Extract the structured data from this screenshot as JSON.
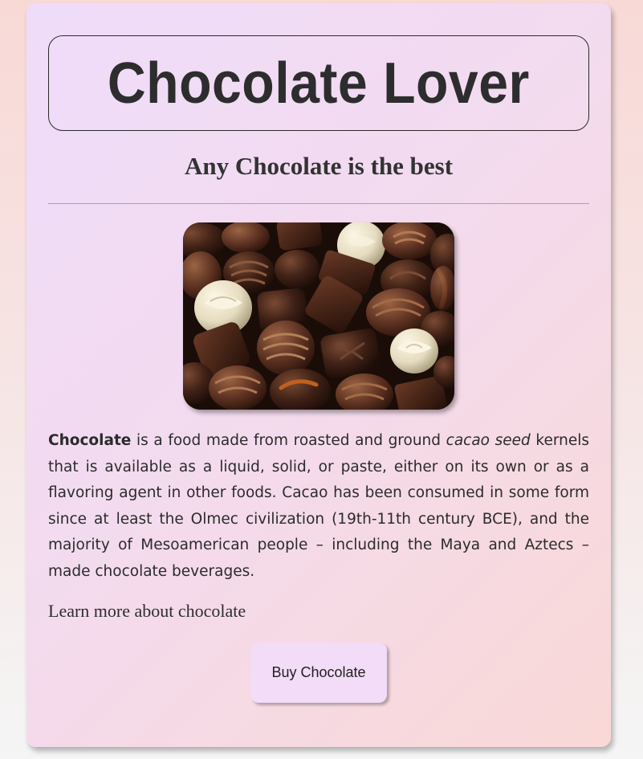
{
  "header": {
    "title": "Chocolate Lover",
    "subtitle": "Any Chocolate is the best"
  },
  "image": {
    "alt": "Assorted chocolate pralines",
    "icon": "chocolate-assortment-photo"
  },
  "article": {
    "lead_bold": "Chocolate",
    "text_1": " is a food made from roasted and ground ",
    "italic": "cacao seed",
    "text_2": " kernels that is available as a liquid, solid, or paste, either on its own or as a flavoring agent in other foods. Cacao has been consumed in some form since at least the Olmec civilization (19th-11th century BCE), and the majority of Mesoamerican people – including the Maya and Aztecs – made chocolate beverages."
  },
  "links": {
    "learn_more": "Learn more about chocolate"
  },
  "actions": {
    "buy_label": "Buy Chocolate"
  },
  "colors": {
    "card_gradient_start": "#efdcfa",
    "card_gradient_end": "#f9d8d6",
    "button_bg": "#f2dcf7",
    "text": "#2d2d2d"
  }
}
